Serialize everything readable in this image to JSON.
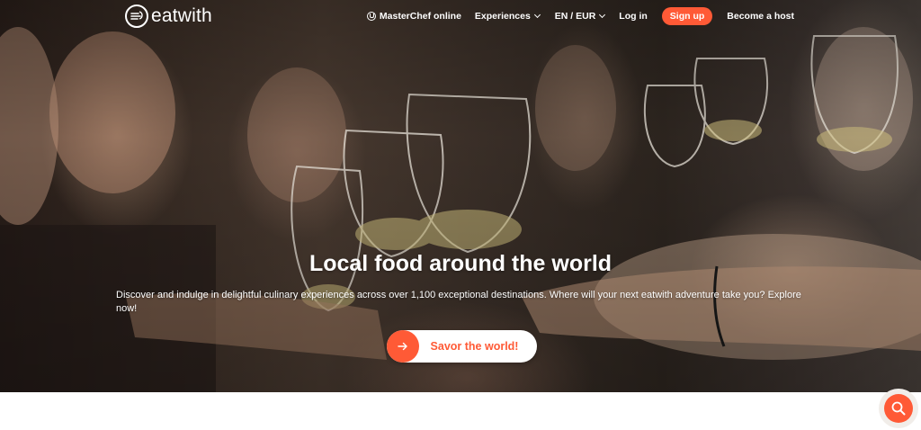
{
  "brand": {
    "name": "eatwith",
    "accent_color": "#ff5a36"
  },
  "nav": {
    "masterchef_label": "MasterChef online",
    "experiences_label": "Experiences",
    "language_label": "EN / EUR",
    "login_label": "Log in",
    "signup_label": "Sign up",
    "become_host_label": "Become a host"
  },
  "hero": {
    "title": "Local food around the world",
    "description": "Discover and indulge in delightful culinary experiences across over 1,100 exceptional destinations. Where will your next eatwith adventure take you? Explore now!",
    "cta_label": "Savor the world!"
  },
  "icons": {
    "logo": "eatwith-logo-icon",
    "masterchef": "chef-hat-icon",
    "dropdown": "chevron-down-icon",
    "cta": "arrow-right-icon",
    "search": "search-icon"
  }
}
